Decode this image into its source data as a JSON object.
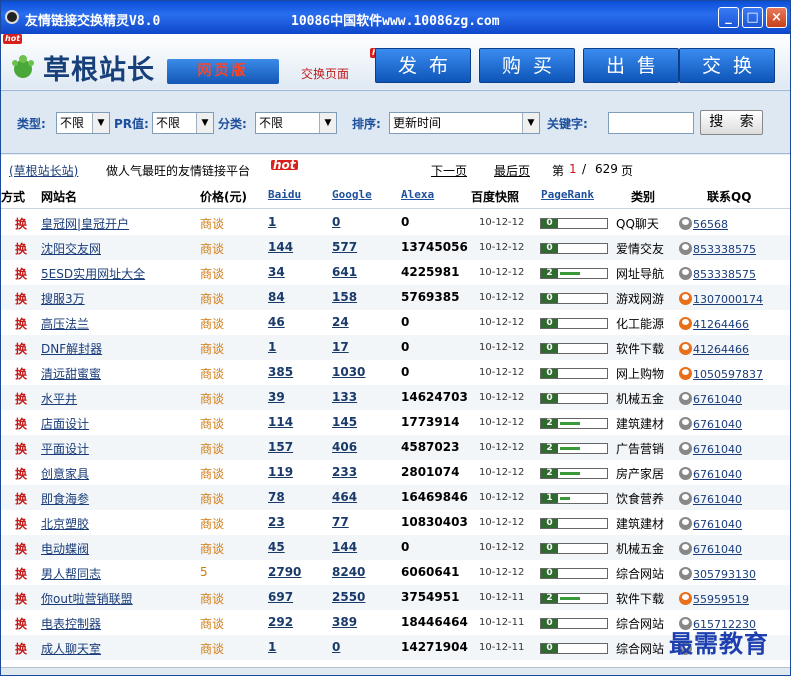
{
  "window": {
    "title": "友情链接交换精灵V8.0",
    "subtitle": "10086中国软件www.10086zg.com",
    "minimize": "_",
    "maximize": "□",
    "close": "×"
  },
  "header": {
    "hot_badge": "hot",
    "logo_text": "草根站长",
    "logo_badge": "网页版",
    "page_label": "交换页面",
    "nav": [
      "发布",
      "购买",
      "出售",
      "交换"
    ]
  },
  "search": {
    "type_label": "类型:",
    "type_value": "不限",
    "pr_label": "PR值:",
    "pr_value": "不限",
    "category_label": "分类:",
    "category_value": "不限",
    "sort_label": "排序:",
    "sort_value": "更新时间",
    "keyword_label": "关键字:",
    "keyword_value": "",
    "search_button": "搜 索"
  },
  "info": {
    "site_link": "(草根站长站)",
    "slogan": "做人气最旺的友情链接平台",
    "next_page": "下一页",
    "last_page": "最后页",
    "page_prefix": "第",
    "current_page": "1",
    "page_sep": "/",
    "total_pages": "629",
    "page_suffix": "页"
  },
  "table": {
    "headers": {
      "mode": "方式",
      "site": "网站名",
      "price": "价格(元)",
      "baidu": "Baidu",
      "google": "Google",
      "alexa": "Alexa",
      "snapshot": "百度快照",
      "pagerank": "PageRank",
      "category": "类别",
      "qq": "联系QQ"
    },
    "rows": [
      {
        "mode": "换",
        "name": "皇冠网|皇冠开户",
        "price": "商谈",
        "baidu": "1",
        "google": "0",
        "alexa": "0",
        "date": "10-12-12",
        "pr": "0",
        "cat": "QQ聊天",
        "qq": "56568",
        "qq_online": false
      },
      {
        "mode": "换",
        "name": "沈阳交友网",
        "price": "商谈",
        "baidu": "144",
        "google": "577",
        "alexa": "13745056",
        "date": "10-12-12",
        "pr": "0",
        "cat": "爱情交友",
        "qq": "853338575",
        "qq_online": false
      },
      {
        "mode": "换",
        "name": "5ESD实用网址大全",
        "price": "商谈",
        "baidu": "34",
        "google": "641",
        "alexa": "4225981",
        "date": "10-12-12",
        "pr": "2",
        "cat": "网址导航",
        "qq": "853338575",
        "qq_online": false
      },
      {
        "mode": "换",
        "name": "搜服3万",
        "price": "商谈",
        "baidu": "84",
        "google": "158",
        "alexa": "5769385",
        "date": "10-12-12",
        "pr": "0",
        "cat": "游戏网游",
        "qq": "1307000174",
        "qq_online": true
      },
      {
        "mode": "换",
        "name": "高压法兰",
        "price": "商谈",
        "baidu": "46",
        "google": "24",
        "alexa": "0",
        "date": "10-12-12",
        "pr": "0",
        "cat": "化工能源",
        "qq": "41264466",
        "qq_online": true
      },
      {
        "mode": "换",
        "name": "DNF解封器",
        "price": "商谈",
        "baidu": "1",
        "google": "17",
        "alexa": "0",
        "date": "10-12-12",
        "pr": "0",
        "cat": "软件下载",
        "qq": "41264466",
        "qq_online": true
      },
      {
        "mode": "换",
        "name": "清远甜蜜蜜",
        "price": "商谈",
        "baidu": "385",
        "google": "1030",
        "alexa": "0",
        "date": "10-12-12",
        "pr": "0",
        "cat": "网上购物",
        "qq": "1050597837",
        "qq_online": true
      },
      {
        "mode": "换",
        "name": "水平井",
        "price": "商谈",
        "baidu": "39",
        "google": "133",
        "alexa": "14624703",
        "date": "10-12-12",
        "pr": "0",
        "cat": "机械五金",
        "qq": "6761040",
        "qq_online": false
      },
      {
        "mode": "换",
        "name": "店面设计",
        "price": "商谈",
        "baidu": "114",
        "google": "145",
        "alexa": "1773914",
        "date": "10-12-12",
        "pr": "2",
        "cat": "建筑建材",
        "qq": "6761040",
        "qq_online": false
      },
      {
        "mode": "换",
        "name": "平面设计",
        "price": "商谈",
        "baidu": "157",
        "google": "406",
        "alexa": "4587023",
        "date": "10-12-12",
        "pr": "2",
        "cat": "广告营销",
        "qq": "6761040",
        "qq_online": false
      },
      {
        "mode": "换",
        "name": "创意家具",
        "price": "商谈",
        "baidu": "119",
        "google": "233",
        "alexa": "2801074",
        "date": "10-12-12",
        "pr": "2",
        "cat": "房产家居",
        "qq": "6761040",
        "qq_online": false
      },
      {
        "mode": "换",
        "name": "即食海参",
        "price": "商谈",
        "baidu": "78",
        "google": "464",
        "alexa": "16469846",
        "date": "10-12-12",
        "pr": "1",
        "cat": "饮食营养",
        "qq": "6761040",
        "qq_online": false
      },
      {
        "mode": "换",
        "name": "北京塑胶",
        "price": "商谈",
        "baidu": "23",
        "google": "77",
        "alexa": "10830403",
        "date": "10-12-12",
        "pr": "0",
        "cat": "建筑建材",
        "qq": "6761040",
        "qq_online": false
      },
      {
        "mode": "换",
        "name": "电动蝶阀",
        "price": "商谈",
        "baidu": "45",
        "google": "144",
        "alexa": "0",
        "date": "10-12-12",
        "pr": "0",
        "cat": "机械五金",
        "qq": "6761040",
        "qq_online": false
      },
      {
        "mode": "换",
        "name": "男人帮同志",
        "price": "5",
        "baidu": "2790",
        "google": "8240",
        "alexa": "6060641",
        "date": "10-12-12",
        "pr": "0",
        "cat": "综合网站",
        "qq": "305793130",
        "qq_online": false
      },
      {
        "mode": "换",
        "name": "你out啦营销联盟",
        "price": "商谈",
        "baidu": "697",
        "google": "2550",
        "alexa": "3754951",
        "date": "10-12-11",
        "pr": "2",
        "cat": "软件下载",
        "qq": "55959519",
        "qq_online": true
      },
      {
        "mode": "换",
        "name": "电表控制器",
        "price": "商谈",
        "baidu": "292",
        "google": "389",
        "alexa": "18446464",
        "date": "10-12-11",
        "pr": "0",
        "cat": "综合网站",
        "qq": "615712230",
        "qq_online": false
      },
      {
        "mode": "换",
        "name": "成人聊天室",
        "price": "商谈",
        "baidu": "1",
        "google": "0",
        "alexa": "14271904",
        "date": "10-12-11",
        "pr": "0",
        "cat": "综合网站",
        "qq": "",
        "qq_online": false
      }
    ]
  },
  "watermark": "最需教育",
  "colors": {
    "titlebar": "#0a4fd6",
    "accent": "#1e4f9c",
    "exchange": "#c41a1a",
    "price": "#d07a10",
    "pr_bar": "#3a9a3a"
  }
}
